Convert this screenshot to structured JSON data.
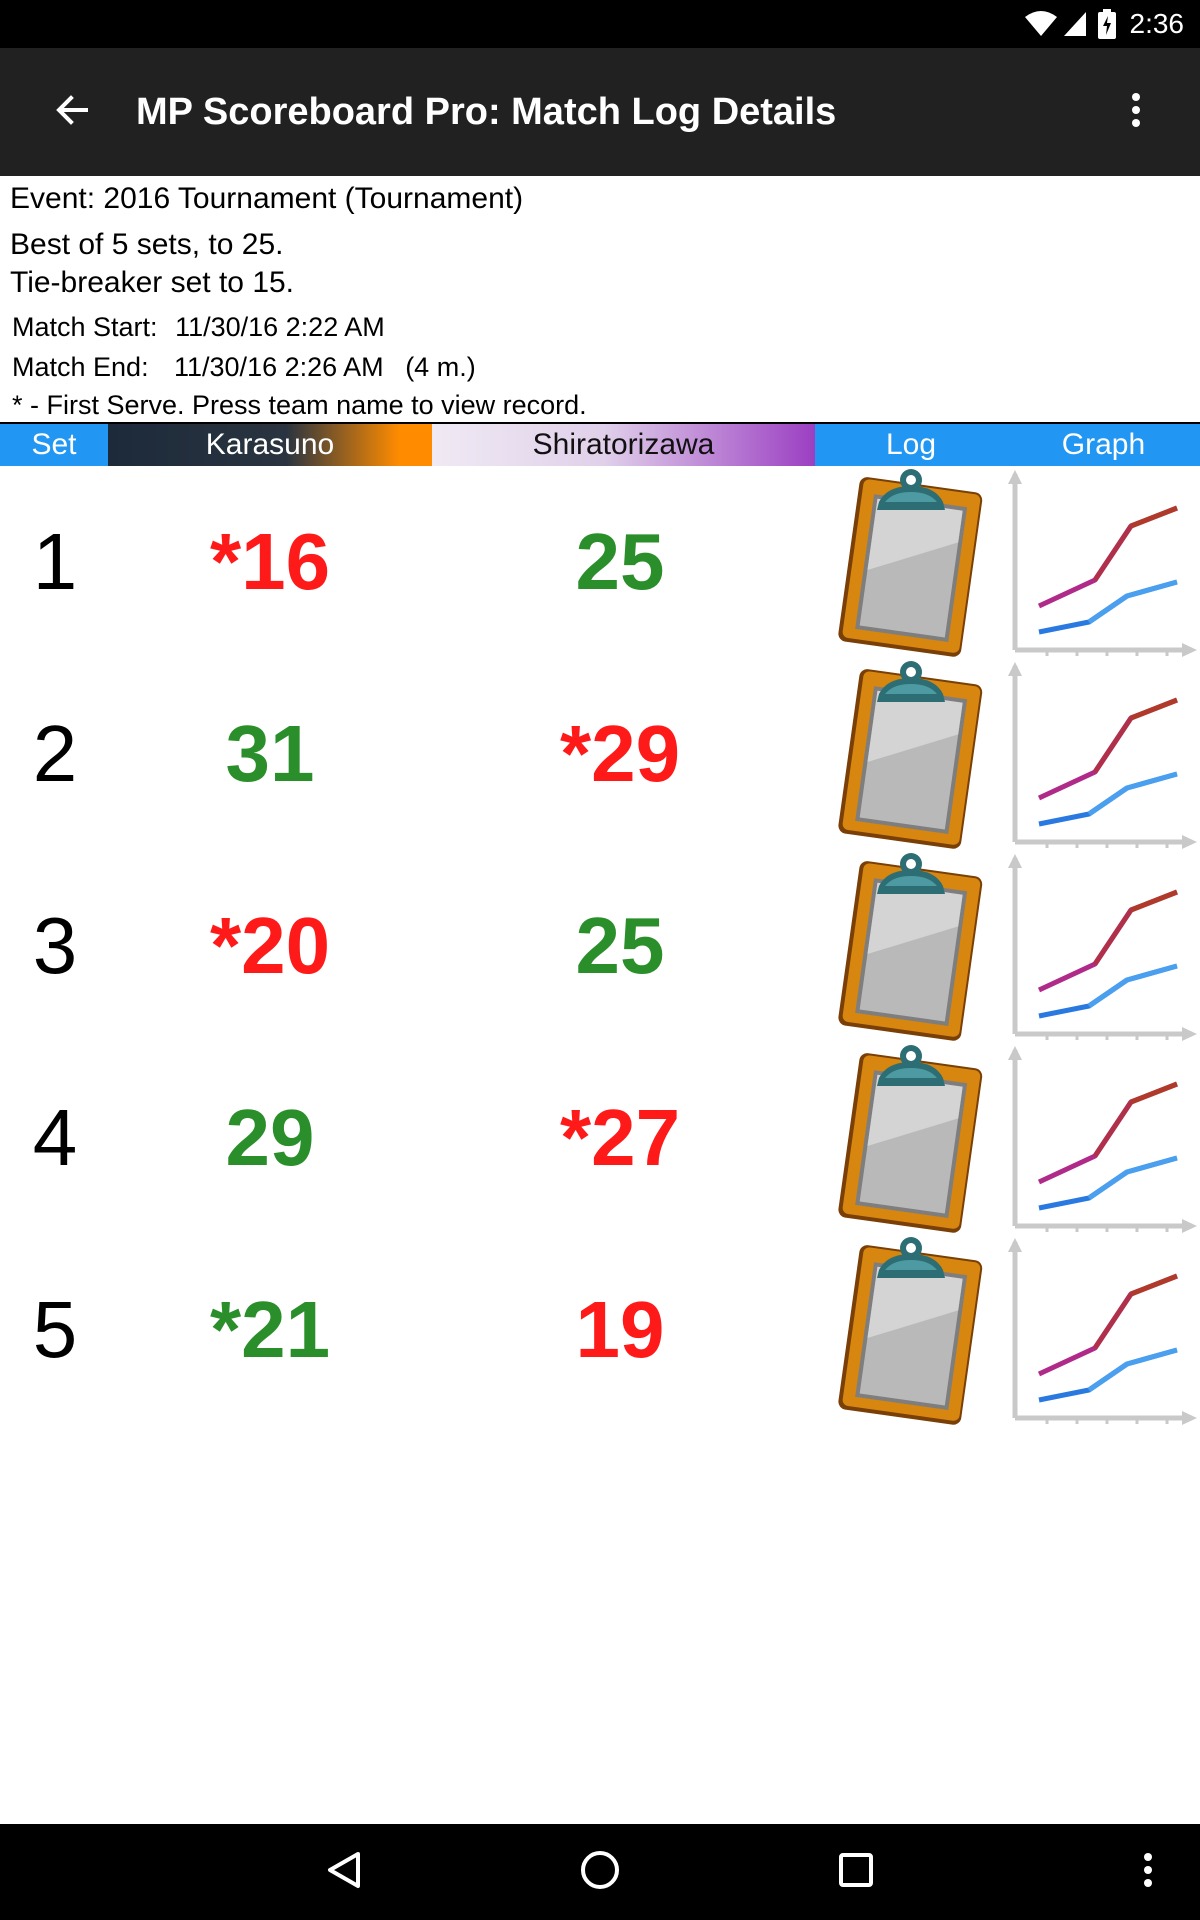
{
  "status_bar": {
    "time": "2:36",
    "icons": [
      "wifi-icon",
      "signal-icon",
      "battery-charging-icon"
    ]
  },
  "app_bar": {
    "title": "MP Scoreboard Pro: Match Log Details",
    "back_icon": "arrow-back-icon",
    "menu_icon": "more-vert-icon"
  },
  "info": {
    "event": "Event: 2016 Tournament (Tournament)",
    "format": "Best of 5 sets, to 25.",
    "tiebreaker": "Tie-breaker set to 15.",
    "match_start_label": "Match Start:",
    "match_start_value": "11/30/16 2:22 AM",
    "match_end_label": "Match End:",
    "match_end_value": "11/30/16 2:26 AM",
    "duration": "(4 m.)",
    "note": "* - First Serve.  Press team name to view record."
  },
  "table": {
    "headers": {
      "set": "Set",
      "team1": "Karasuno",
      "team2": "Shiratorizawa",
      "log": "Log",
      "graph": "Graph"
    },
    "rows": [
      {
        "set": "1",
        "team1": "*16",
        "team2": "25",
        "team1_color": "#ff1a1a",
        "team2_color": "#2a8f2a"
      },
      {
        "set": "2",
        "team1": "31",
        "team2": "*29",
        "team1_color": "#2a8f2a",
        "team2_color": "#ff1a1a"
      },
      {
        "set": "3",
        "team1": "*20",
        "team2": "25",
        "team1_color": "#ff1a1a",
        "team2_color": "#2a8f2a"
      },
      {
        "set": "4",
        "team1": "29",
        "team2": "*27",
        "team1_color": "#2a8f2a",
        "team2_color": "#ff1a1a"
      },
      {
        "set": "5",
        "team1": "*21",
        "team2": "19",
        "team1_color": "#2a8f2a",
        "team2_color": "#ff1a1a"
      }
    ]
  },
  "colors": {
    "header_blue": "#2196f3",
    "team1_accent": "#ff8c00",
    "team2_accent": "#9b3fc2",
    "app_bar": "#212121"
  },
  "nav_bar": {
    "icons": [
      "back-triangle-icon",
      "home-circle-icon",
      "recents-square-icon",
      "more-vert-icon"
    ]
  }
}
